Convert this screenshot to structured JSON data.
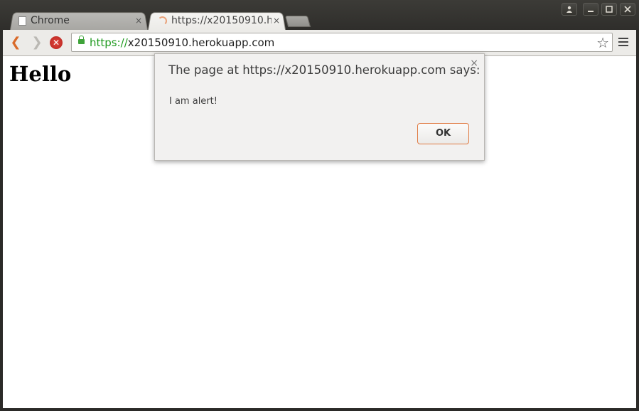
{
  "window": {
    "controls": [
      "person-icon",
      "minimize-icon",
      "maximize-icon",
      "close-icon"
    ]
  },
  "tabs": [
    {
      "title": "Chrome",
      "icon": "page-icon",
      "close": "×",
      "active": false
    },
    {
      "title": "https://x20150910.h",
      "icon": "loading-spinner-icon",
      "close": "×",
      "active": true
    }
  ],
  "toolbar": {
    "url_scheme": "https://",
    "url_host": "x20150910.herokuapp.com",
    "back_glyph": "❮",
    "forward_glyph": "❯",
    "stop_glyph": "✕",
    "star_glyph": "☆"
  },
  "page": {
    "heading": "Hello"
  },
  "dialog": {
    "title": "The page at https://x20150910.herokuapp.com says:",
    "message": "I am alert!",
    "ok_label": "OK",
    "close_glyph": "×"
  },
  "colors": {
    "accent": "#e07b43",
    "secure_green": "#1f9a1f",
    "stop_red": "#c9302c"
  }
}
